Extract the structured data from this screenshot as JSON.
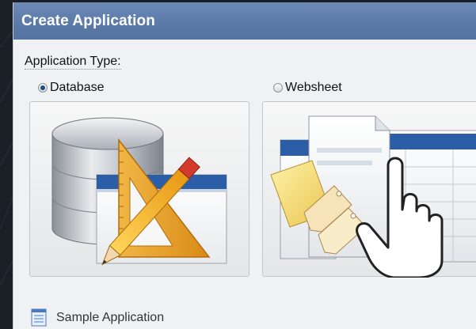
{
  "dialog": {
    "title": "Create Application"
  },
  "application_type": {
    "label": "Application Type:",
    "options": [
      {
        "label": "Database",
        "selected": true,
        "icon": "database-icon"
      },
      {
        "label": "Websheet",
        "selected": false,
        "icon": "websheet-icon"
      }
    ]
  },
  "sample": {
    "label": "Sample Application",
    "icon": "document-icon"
  },
  "colors": {
    "titlebar": "#5c7aa8",
    "dialog_bg": "#f0f1f2",
    "page_bg": "#1b2027",
    "accent_blue": "#2a5a9e"
  }
}
